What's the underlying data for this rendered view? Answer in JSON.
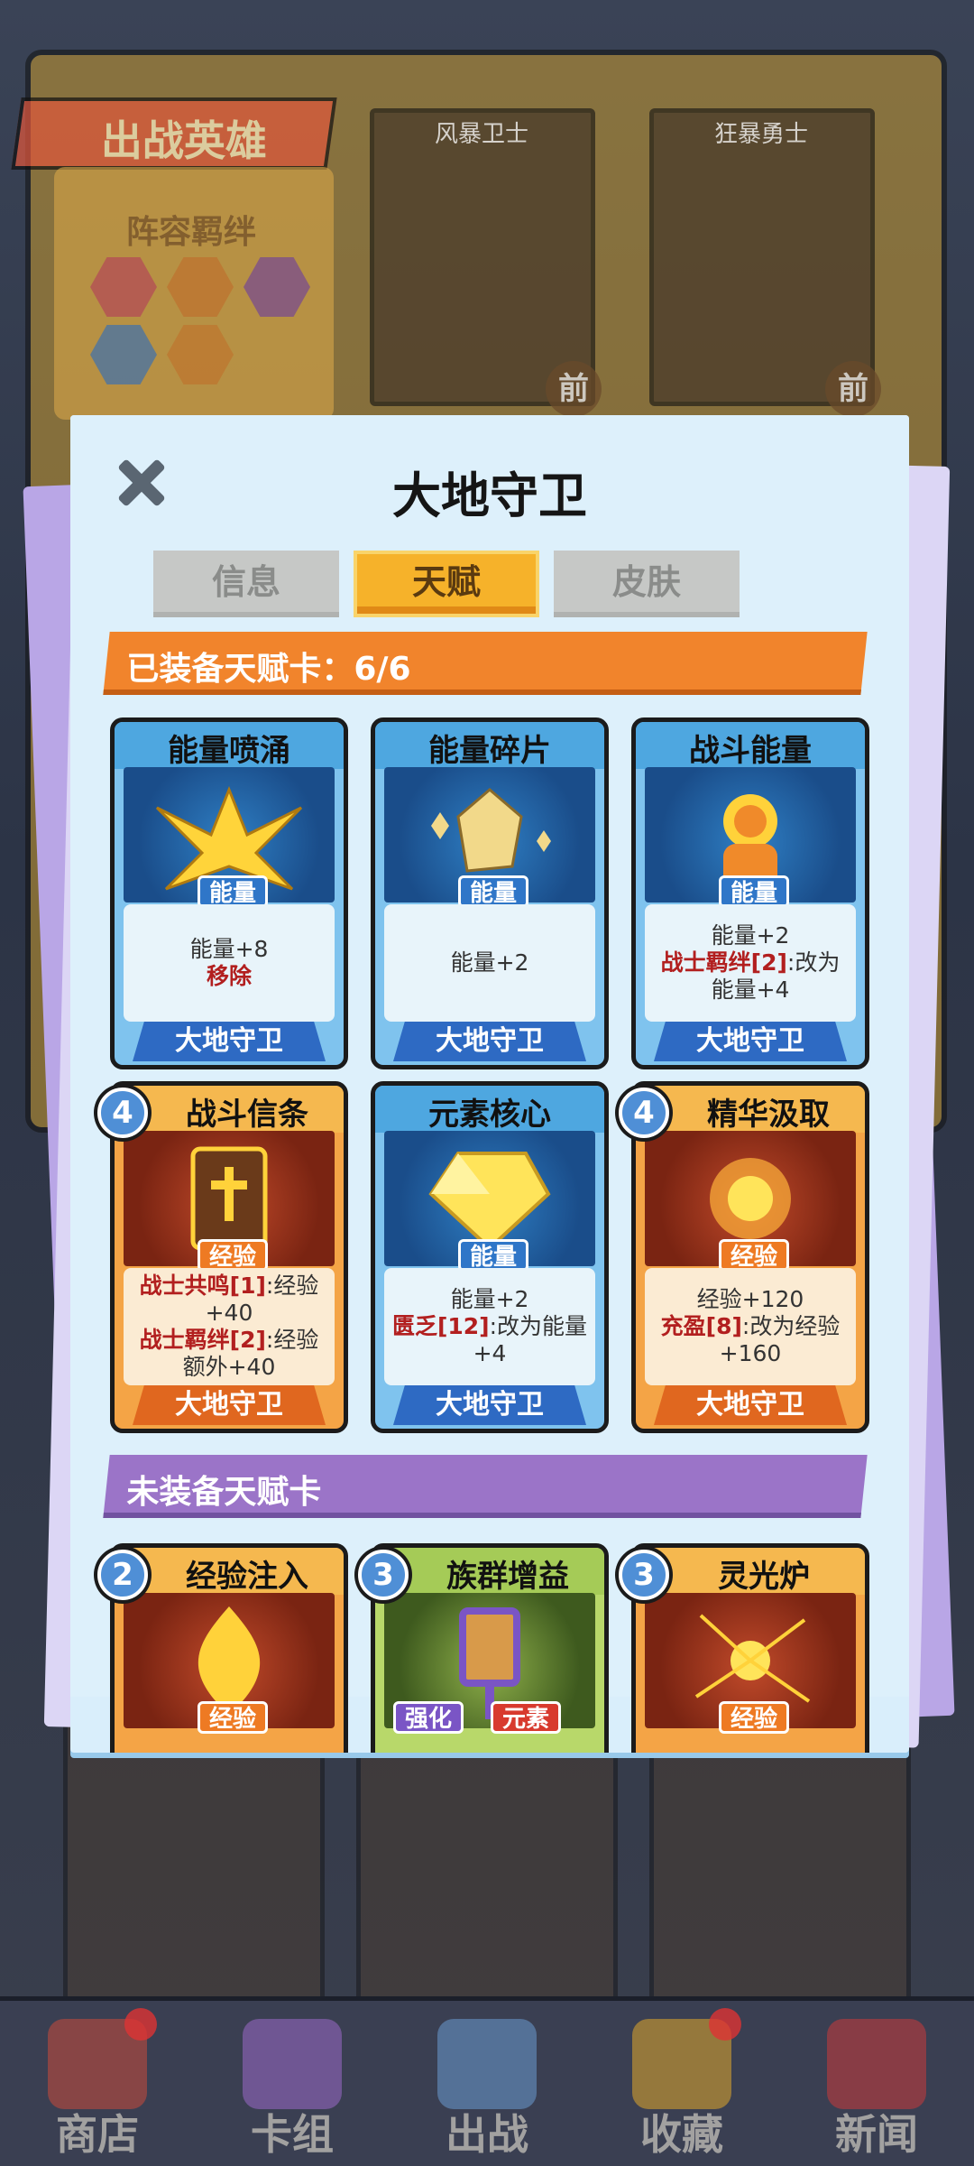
{
  "background": {
    "title": "出战英雄",
    "bond_title": "阵容羁绊",
    "cards": [
      {
        "name": "风暴卫士",
        "tag": "前"
      },
      {
        "name": "狂暴勇士",
        "tag": "前"
      }
    ]
  },
  "modal": {
    "title": "大地守卫",
    "tabs": [
      {
        "label": "信息",
        "active": false
      },
      {
        "label": "天赋",
        "active": true
      },
      {
        "label": "皮肤",
        "active": false
      }
    ],
    "equipped_banner": "已装备天赋卡：6/6",
    "unequipped_banner": "未装备天赋卡",
    "equipped_cards": [
      {
        "name": "能量喷涌",
        "type": "能量",
        "color": "blue",
        "cost": null,
        "desc": [
          "能量+8"
        ],
        "red_desc": "移除",
        "hero": "大地守卫"
      },
      {
        "name": "能量碎片",
        "type": "能量",
        "color": "blue",
        "cost": null,
        "desc": [
          "能量+2"
        ],
        "hero": "大地守卫"
      },
      {
        "name": "战斗能量",
        "type": "能量",
        "color": "blue",
        "cost": null,
        "desc": [
          "能量+2"
        ],
        "bond_label": "战士羁绊[2]",
        "bond_text": ":改为",
        "bond_text2": "能量+4",
        "hero": "大地守卫"
      },
      {
        "name": "战斗信条",
        "type": "经验",
        "color": "orange",
        "cost": "4",
        "line1_red": "战士共鸣[1]",
        "line1_text": ":经验",
        "line1_text2": "+40",
        "line2_red": "战士羁绊[2]",
        "line2_text": ":经验",
        "line2_text2": "额外+40",
        "hero": "大地守卫"
      },
      {
        "name": "元素核心",
        "type": "能量",
        "color": "blue",
        "cost": null,
        "desc": [
          "能量+2"
        ],
        "bond_label": "匮乏[12]",
        "bond_text": ":改为能量",
        "bond_text2": "+4",
        "hero": "大地守卫"
      },
      {
        "name": "精华汲取",
        "type": "经验",
        "color": "orange",
        "cost": "4",
        "desc": [
          "经验+120"
        ],
        "bond_label": "充盈[8]",
        "bond_text": ":改为经验",
        "bond_text2": "+160",
        "hero": "大地守卫"
      }
    ],
    "unequipped_cards": [
      {
        "name": "经验注入",
        "cost": "2",
        "type": "经验",
        "color": "orange"
      },
      {
        "name": "族群增益",
        "cost": "3",
        "type": "强化",
        "type2": "元素",
        "color": "green"
      },
      {
        "name": "灵光炉",
        "cost": "3",
        "type": "经验",
        "color": "orange"
      }
    ]
  },
  "bottom_nav": [
    {
      "label": "商店",
      "icon": "shop-icon",
      "dot": true
    },
    {
      "label": "卡组",
      "icon": "deck-icon",
      "dot": false
    },
    {
      "label": "出战",
      "icon": "battle-icon",
      "dot": false
    },
    {
      "label": "收藏",
      "icon": "collection-icon",
      "dot": true
    },
    {
      "label": "新闻",
      "icon": "news-icon",
      "dot": false
    }
  ],
  "colors": {
    "equipped_banner": "#f1842c",
    "unequipped_banner": "#9b74c8",
    "active_tab": "#f6b22a",
    "modal_bg": "#ddf0fb"
  }
}
